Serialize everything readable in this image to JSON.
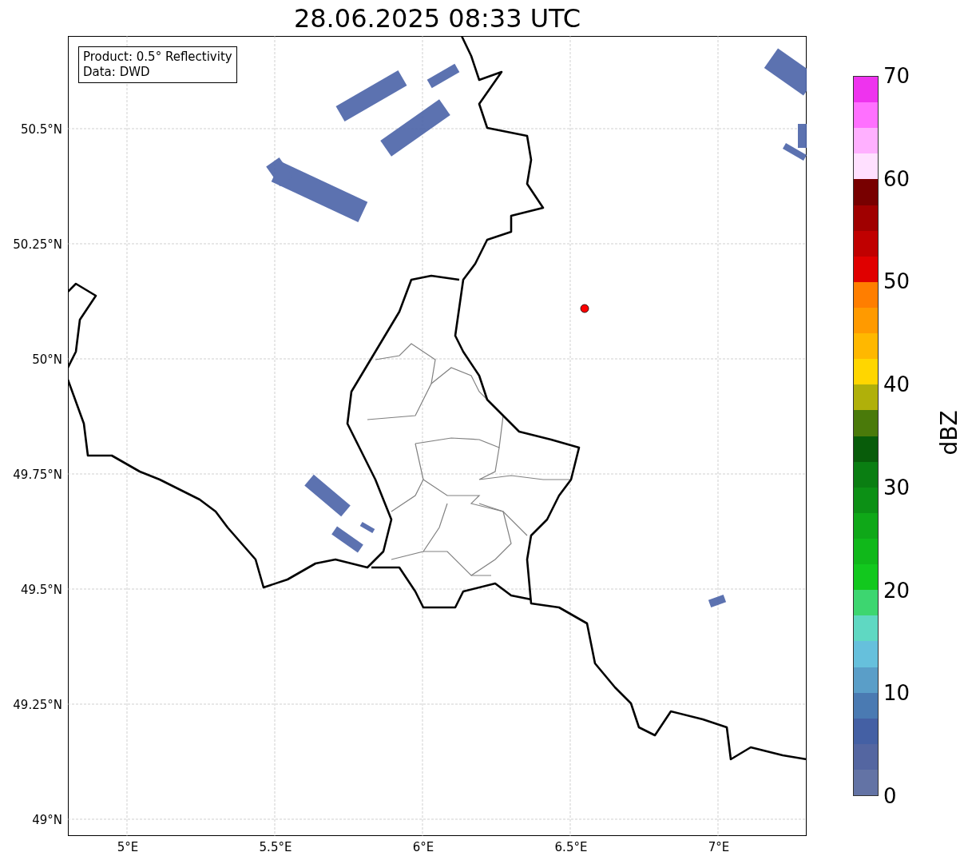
{
  "title": "28.06.2025 08:33 UTC",
  "info": [
    "Product: 0.5° Reflectivity",
    "Data: DWD"
  ],
  "map": {
    "lat_ticks": [
      "50.5°N",
      "50.25°N",
      "50°N",
      "49.75°N",
      "49.5°N",
      "49.25°N",
      "49°N"
    ],
    "lon_ticks": [
      "5°E",
      "5.5°E",
      "6°E",
      "6.5°E",
      "7°E"
    ]
  },
  "colorbar": {
    "label": "dBZ",
    "ticks": [
      "70",
      "60",
      "50",
      "40",
      "30",
      "20",
      "10",
      "0"
    ],
    "steps": [
      {
        "color": "#ee33ee"
      },
      {
        "color": "#ff70ff"
      },
      {
        "color": "#ffb0ff"
      },
      {
        "color": "#ffe0ff"
      },
      {
        "color": "#780000"
      },
      {
        "color": "#a00000"
      },
      {
        "color": "#c00000"
      },
      {
        "color": "#e00000"
      },
      {
        "color": "#ff7e00"
      },
      {
        "color": "#ff9a00"
      },
      {
        "color": "#ffb800"
      },
      {
        "color": "#ffd600"
      },
      {
        "color": "#b0b00a"
      },
      {
        "color": "#4a7a0a"
      },
      {
        "color": "#085c0a"
      },
      {
        "color": "#0a7e12"
      },
      {
        "color": "#0c9015"
      },
      {
        "color": "#0fa818"
      },
      {
        "color": "#10b81a"
      },
      {
        "color": "#12c81e"
      },
      {
        "color": "#3dd670"
      },
      {
        "color": "#5fd8c2"
      },
      {
        "color": "#66c0dc"
      },
      {
        "color": "#5a9ec8"
      },
      {
        "color": "#4a7ab2"
      },
      {
        "color": "#4460a4"
      },
      {
        "color": "#5466a1"
      },
      {
        "color": "#6373a5"
      }
    ]
  }
}
